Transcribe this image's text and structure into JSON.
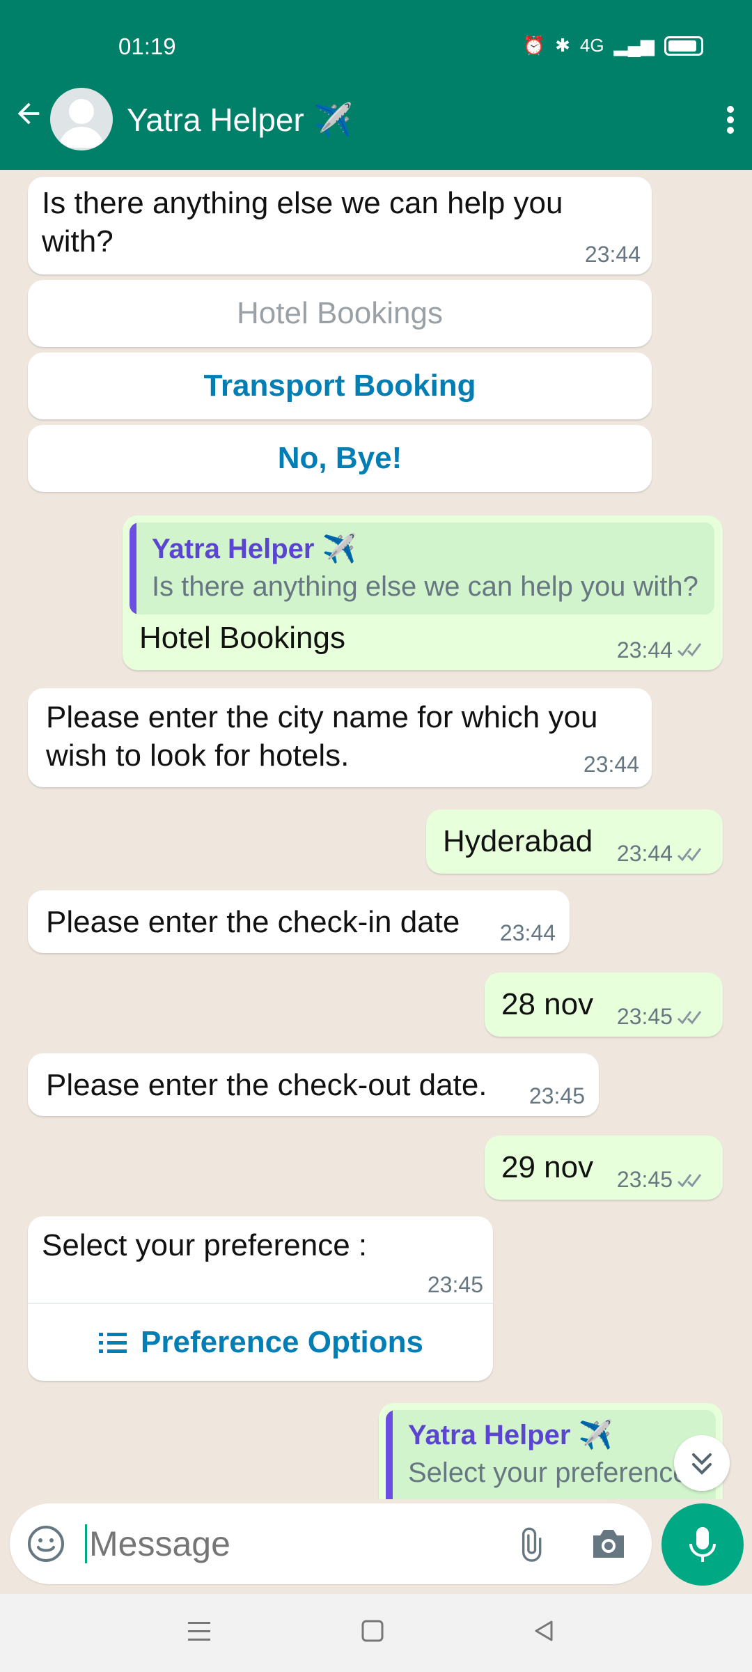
{
  "status": {
    "time": "01:19",
    "network": "4G"
  },
  "header": {
    "title": "Yatra Helper ✈️"
  },
  "messages": [
    {
      "text": "Is there anything else we can help you with?",
      "time": "23:44"
    },
    {
      "quote_name": "Yatra Helper ✈️",
      "quote_text": "Is there anything else we can help you with?",
      "text": "Hotel Bookings",
      "time": "23:44"
    },
    {
      "text": "Please enter the city name for which you wish to look for hotels.",
      "time": "23:44"
    },
    {
      "text": "Hyderabad",
      "time": "23:44"
    },
    {
      "text": "Please enter the check-in date",
      "time": "23:44"
    },
    {
      "text": "28 nov",
      "time": "23:45"
    },
    {
      "text": "Please enter the check-out date.",
      "time": "23:45"
    },
    {
      "text": "29 nov",
      "time": "23:45"
    },
    {
      "text": "Select your preference :",
      "time": "23:45",
      "button": "Preference Options"
    },
    {
      "quote_name": "Yatra Helper ✈️",
      "quote_text": "Select your preference"
    }
  ],
  "quick_replies": [
    "Hotel Bookings",
    "Transport Booking",
    "No, Bye!"
  ],
  "input": {
    "placeholder": "Message"
  },
  "colors": {
    "header": "#008069",
    "accent": "#00a884",
    "link": "#027eb5"
  }
}
